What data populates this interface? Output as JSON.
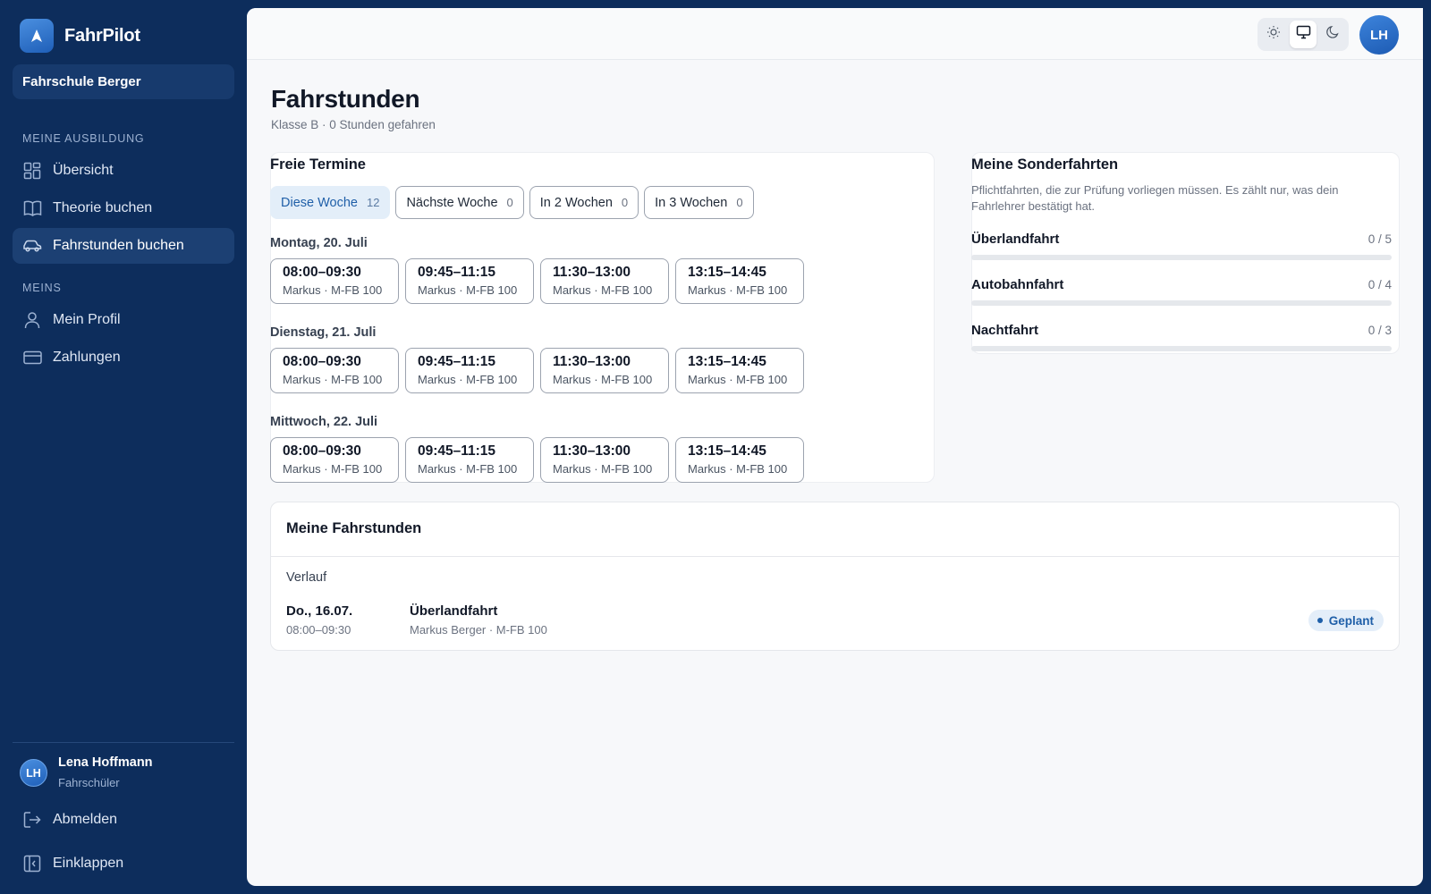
{
  "app": {
    "name": "FahrPilot",
    "school": "Fahrschule Berger"
  },
  "sidebar": {
    "section_ausbildung": "MEINE AUSBILDUNG",
    "section_meins": "MEINS",
    "items": [
      {
        "label": "Übersicht",
        "icon": "dashboard-icon"
      },
      {
        "label": "Theorie buchen",
        "icon": "book-icon"
      },
      {
        "label": "Fahrstunden buchen",
        "icon": "car-icon"
      },
      {
        "label": "Mein Profil",
        "icon": "user-icon"
      },
      {
        "label": "Zahlungen",
        "icon": "credit-card-icon"
      }
    ],
    "user": {
      "initials": "LH",
      "name": "Lena Hoffmann",
      "role": "Fahrschüler"
    },
    "logout": "Abmelden",
    "collapse": "Einklappen"
  },
  "topbar": {
    "avatar_initials": "LH",
    "theme_modes": [
      "sun-icon",
      "monitor-icon",
      "moon-icon"
    ],
    "active_theme": "monitor-icon"
  },
  "page": {
    "title": "Fahrstunden",
    "subtitle": "Klasse B · 0 Stunden gefahren"
  },
  "free_slots": {
    "title": "Freie Termine",
    "tabs": [
      {
        "label": "Diese Woche",
        "count": "12"
      },
      {
        "label": "Nächste Woche",
        "count": "0"
      },
      {
        "label": "In 2 Wochen",
        "count": "0"
      },
      {
        "label": "In 3 Wochen",
        "count": "0"
      }
    ],
    "days": [
      {
        "label": "Montag, 20. Juli",
        "slots": [
          {
            "time": "08:00–09:30",
            "meta": "Markus · M-FB 100"
          },
          {
            "time": "09:45–11:15",
            "meta": "Markus · M-FB 100"
          },
          {
            "time": "11:30–13:00",
            "meta": "Markus · M-FB 100"
          },
          {
            "time": "13:15–14:45",
            "meta": "Markus · M-FB 100"
          }
        ]
      },
      {
        "label": "Dienstag, 21. Juli",
        "slots": [
          {
            "time": "08:00–09:30",
            "meta": "Markus · M-FB 100"
          },
          {
            "time": "09:45–11:15",
            "meta": "Markus · M-FB 100"
          },
          {
            "time": "11:30–13:00",
            "meta": "Markus · M-FB 100"
          },
          {
            "time": "13:15–14:45",
            "meta": "Markus · M-FB 100"
          }
        ]
      },
      {
        "label": "Mittwoch, 22. Juli",
        "slots": [
          {
            "time": "08:00–09:30",
            "meta": "Markus · M-FB 100"
          },
          {
            "time": "09:45–11:15",
            "meta": "Markus · M-FB 100"
          },
          {
            "time": "11:30–13:00",
            "meta": "Markus · M-FB 100"
          },
          {
            "time": "13:15–14:45",
            "meta": "Markus · M-FB 100"
          }
        ]
      }
    ]
  },
  "special_drives": {
    "title": "Meine Sonderfahrten",
    "description": "Pflichtfahrten, die zur Prüfung vorliegen müssen. Es zählt nur, was dein Fahrlehrer bestätigt hat.",
    "items": [
      {
        "name": "Überlandfahrt",
        "count": "0 / 5",
        "progress": 0
      },
      {
        "name": "Autobahnfahrt",
        "count": "0 / 4",
        "progress": 0
      },
      {
        "name": "Nachtfahrt",
        "count": "0 / 3",
        "progress": 0
      }
    ]
  },
  "my_lessons": {
    "title": "Meine Fahrstunden",
    "history_label": "Verlauf",
    "entries": [
      {
        "date": "Do., 16.07.",
        "time": "08:00–09:30",
        "type": "Überlandfahrt",
        "meta": "Markus Berger · M-FB 100",
        "status": "Geplant"
      }
    ]
  },
  "colors": {
    "sidebar": "#0d2d5c",
    "accent": "#1f5fa8",
    "active_tab": "#e3eef9"
  }
}
